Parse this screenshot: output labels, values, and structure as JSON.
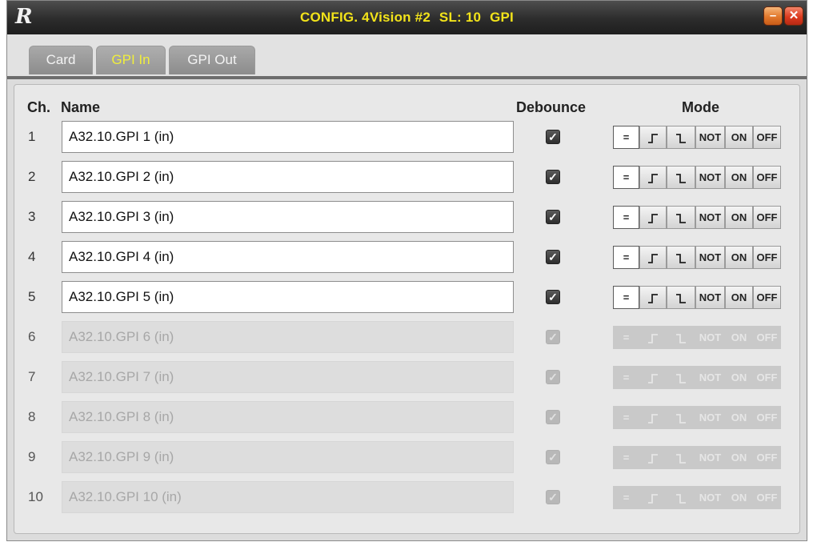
{
  "window": {
    "logo": "R",
    "title_parts": [
      "CONFIG. 4Vision #2",
      "SL: 10",
      "GPI"
    ],
    "minimize_glyph": "–",
    "close_glyph": "✕"
  },
  "tabs": [
    {
      "label": "Card",
      "active": false
    },
    {
      "label": "GPI In",
      "active": true
    },
    {
      "label": "GPI Out",
      "active": false
    }
  ],
  "headers": {
    "ch": "Ch.",
    "name": "Name",
    "debounce": "Debounce",
    "mode": "Mode"
  },
  "mode_buttons": [
    "=",
    "⌐",
    "⌐",
    "NOT",
    "ON",
    "OFF"
  ],
  "rows": [
    {
      "ch": "1",
      "name": "A32.10.GPI 1 (in)",
      "debounce": true,
      "enabled": true
    },
    {
      "ch": "2",
      "name": "A32.10.GPI 2 (in)",
      "debounce": true,
      "enabled": true
    },
    {
      "ch": "3",
      "name": "A32.10.GPI 3 (in)",
      "debounce": true,
      "enabled": true
    },
    {
      "ch": "4",
      "name": "A32.10.GPI 4 (in)",
      "debounce": true,
      "enabled": true
    },
    {
      "ch": "5",
      "name": "A32.10.GPI 5 (in)",
      "debounce": true,
      "enabled": true
    },
    {
      "ch": "6",
      "name": "A32.10.GPI 6 (in)",
      "debounce": true,
      "enabled": false
    },
    {
      "ch": "7",
      "name": "A32.10.GPI 7 (in)",
      "debounce": true,
      "enabled": false
    },
    {
      "ch": "8",
      "name": "A32.10.GPI 8 (in)",
      "debounce": true,
      "enabled": false
    },
    {
      "ch": "9",
      "name": "A32.10.GPI 9 (in)",
      "debounce": true,
      "enabled": false
    },
    {
      "ch": "10",
      "name": "A32.10.GPI 10 (in)",
      "debounce": true,
      "enabled": false
    }
  ],
  "colors": {
    "title": "#f2e31a",
    "active_tab_text": "#f0ee3c"
  }
}
